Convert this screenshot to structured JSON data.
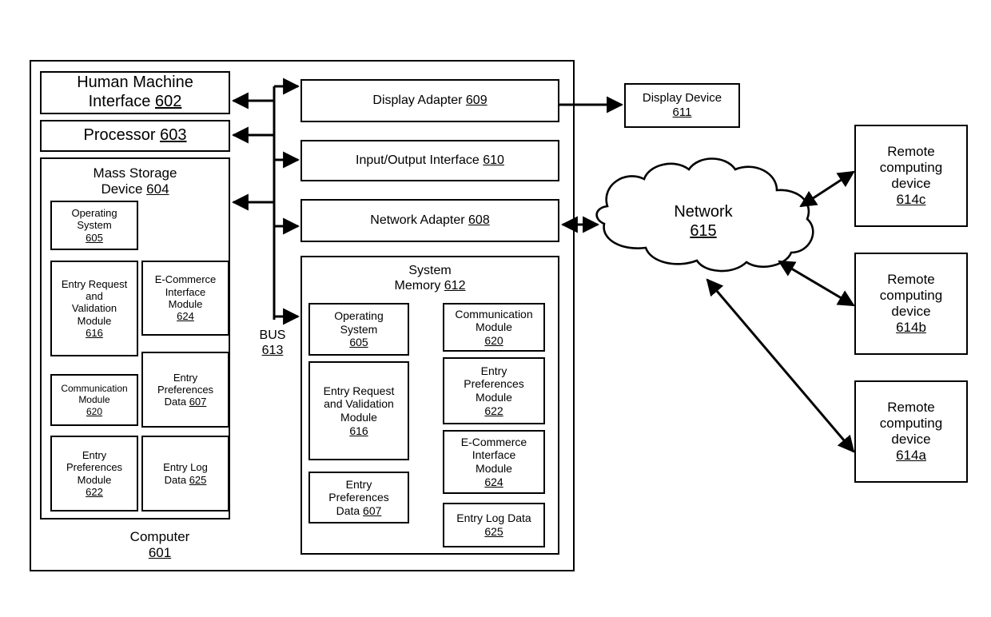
{
  "diagram": {
    "computer": {
      "label": "Computer",
      "ref": "601"
    },
    "bus": {
      "label": "BUS",
      "ref": "613"
    }
  },
  "left_column": {
    "hmi": {
      "line1": "Human Machine",
      "line2": "Interface",
      "ref": "602"
    },
    "processor": {
      "line1": "Processor",
      "ref": "603"
    },
    "mass_storage": {
      "line1": "Mass Storage",
      "line2": "Device",
      "ref": "604",
      "modules": [
        {
          "lines": [
            "Operating",
            "System"
          ],
          "ref": "605",
          "size": "small"
        },
        {
          "lines": [
            "Entry Request",
            "and",
            "Validation",
            "Module"
          ],
          "ref": "616",
          "size": "small"
        },
        {
          "lines": [
            "E-Commerce",
            "Interface",
            "Module"
          ],
          "ref": "624",
          "size": "small"
        },
        {
          "lines": [
            "Communication",
            "Module"
          ],
          "ref": "620",
          "size": "tiny"
        },
        {
          "lines": [
            "Entry",
            "Preferences",
            "Data"
          ],
          "ref": "607",
          "size": "small",
          "inline_ref": true
        },
        {
          "lines": [
            "Entry",
            "Preferences",
            "Module"
          ],
          "ref": "622",
          "size": "small"
        },
        {
          "lines": [
            "Entry Log",
            "Data"
          ],
          "ref": "625",
          "size": "small",
          "inline_ref": true
        }
      ]
    }
  },
  "right_column": {
    "display_adapter": {
      "label": "Display Adapter",
      "ref": "609"
    },
    "io_interface": {
      "label": "Input/Output Interface",
      "ref": "610"
    },
    "network_adapter": {
      "label": "Network Adapter",
      "ref": "608"
    },
    "system_memory": {
      "line1": "System",
      "line2": "Memory",
      "ref": "612",
      "modules": [
        {
          "lines": [
            "Operating",
            "System"
          ],
          "ref": "605"
        },
        {
          "lines": [
            "Communication",
            "Module"
          ],
          "ref": "620"
        },
        {
          "lines": [
            "Entry Request",
            "and Validation",
            "Module"
          ],
          "ref": "616"
        },
        {
          "lines": [
            "Entry",
            "Preferences",
            "Module"
          ],
          "ref": "622"
        },
        {
          "lines": [
            "Entry",
            "Preferences",
            "Data"
          ],
          "ref": "607",
          "inline_ref": true
        },
        {
          "lines": [
            "E-Commerce",
            "Interface",
            "Module"
          ],
          "ref": "624"
        },
        {
          "lines": [
            "Entry Log Data"
          ],
          "ref": "625"
        }
      ]
    }
  },
  "external": {
    "display_device": {
      "line1": "Display Device",
      "ref": "611"
    },
    "network": {
      "label": "Network",
      "ref": "615"
    },
    "remote_devices": [
      {
        "line1": "Remote",
        "line2": "computing",
        "line3": "device",
        "ref": "614c"
      },
      {
        "line1": "Remote",
        "line2": "computing",
        "line3": "device",
        "ref": "614b"
      },
      {
        "line1": "Remote",
        "line2": "computing",
        "line3": "device",
        "ref": "614a"
      }
    ]
  },
  "style": {
    "stroke": "#000000",
    "background": "#ffffff"
  }
}
